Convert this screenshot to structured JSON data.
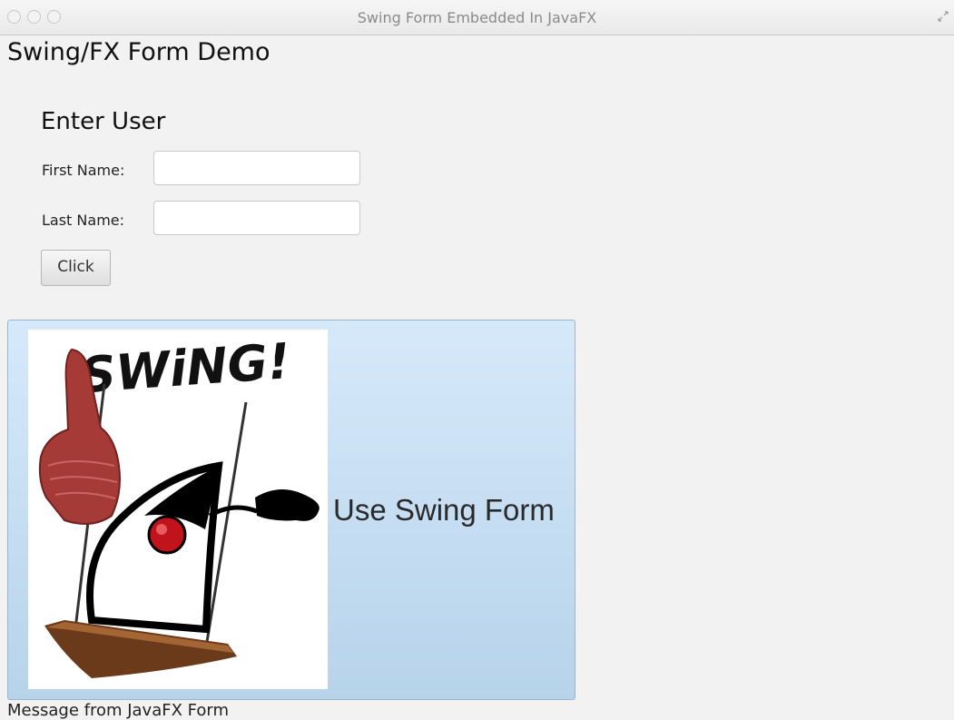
{
  "window": {
    "title": "Swing Form Embedded In JavaFX"
  },
  "app": {
    "heading": "Swing/FX Form Demo"
  },
  "form": {
    "title": "Enter User",
    "first_name": {
      "label": "First Name:",
      "value": ""
    },
    "last_name": {
      "label": "Last Name:",
      "value": ""
    },
    "button_label": "Click"
  },
  "swing_panel": {
    "label": "Use Swing Form",
    "image_text": "SWiNG!"
  },
  "status": {
    "message": "Message from JavaFX Form"
  },
  "colors": {
    "panel_top": "#d6e9fb",
    "panel_bottom": "#b7d3ea",
    "foam_finger": "#a63a37",
    "duke_nose": "#c0131b"
  }
}
